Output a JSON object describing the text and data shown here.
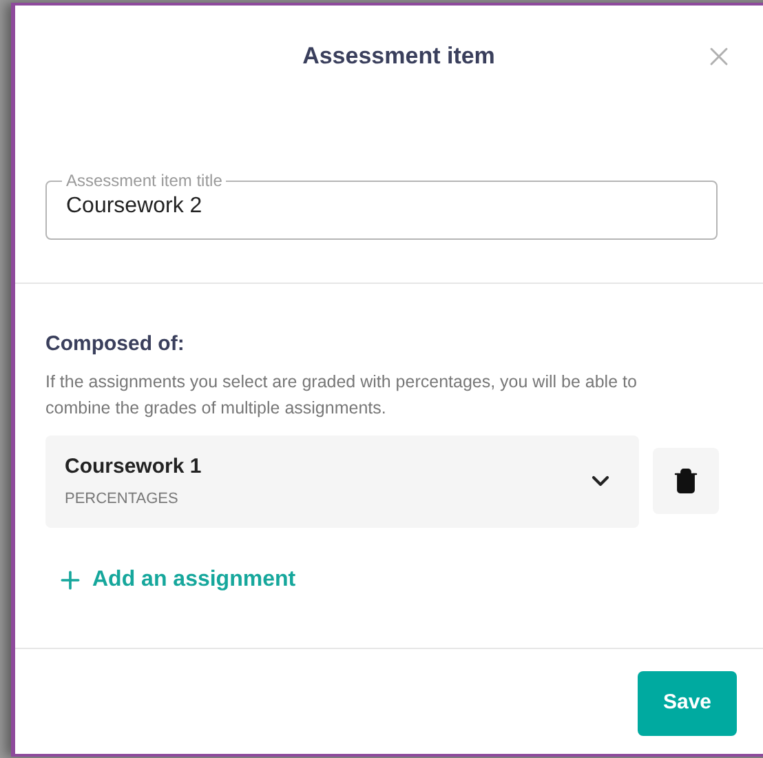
{
  "dialog": {
    "title": "Assessment item"
  },
  "title_field": {
    "label": "Assessment item title",
    "value": "Coursework 2"
  },
  "composed_of": {
    "heading": "Composed of:",
    "description": "If the assignments you select are graded with percentages, you will be able to combine the grades of multiple assignments.",
    "assignments": [
      {
        "name": "Coursework 1",
        "grading": "PERCENTAGES",
        "expanded": false
      }
    ],
    "add_link": "Add an assignment"
  },
  "footer": {
    "save": "Save"
  }
}
